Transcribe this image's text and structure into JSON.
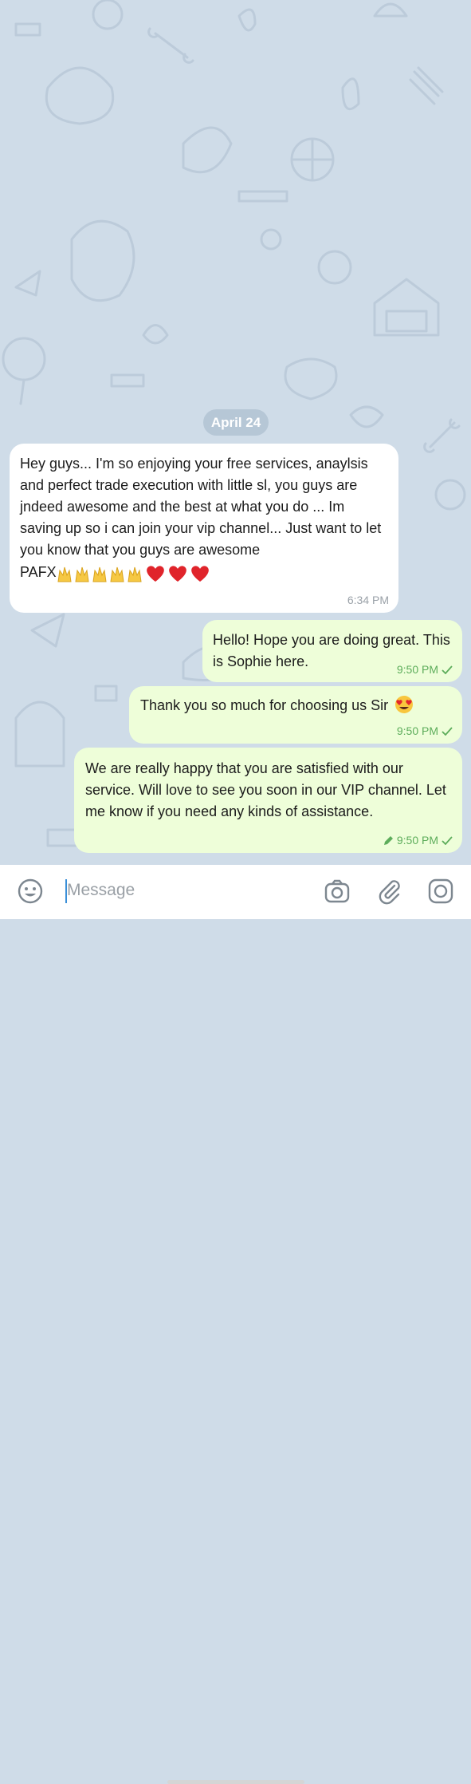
{
  "chat": {
    "date_separator": "April 24",
    "messages": [
      {
        "direction": "incoming",
        "text": "Hey guys... I'm so enjoying your free services, anaylsis and perfect trade execution with little sl, you guys are jndeed awesome and the best at what you do ... Im saving up so i can join your vip channel... Just want to let you know that you guys are awesome",
        "signature": "PAFX",
        "emoji": [
          "raising-hands",
          "raising-hands",
          "raising-hands",
          "raising-hands",
          "raising-hands",
          "red-heart",
          "red-heart",
          "red-heart"
        ],
        "time": "6:34 PM"
      },
      {
        "direction": "outgoing",
        "text": "Hello! Hope you are doing great. This is Sophie here.",
        "time": "9:50 PM",
        "status": "sent-check"
      },
      {
        "direction": "outgoing",
        "text": "Thank you so much for choosing us Sir",
        "emoji": [
          "heart-eyes"
        ],
        "time": "9:50 PM",
        "status": "sent-check"
      },
      {
        "direction": "outgoing",
        "text": "We are really happy that you are satisfied with our service. Will love to see you soon in our VIP channel. Let me know if you need any kinds of assistance.",
        "edited_icon": "pencil-icon",
        "time": "9:50 PM",
        "status": "sent-check"
      }
    ]
  },
  "input_bar": {
    "placeholder": "Message",
    "icons": [
      "emoji-icon",
      "camera-icon",
      "attach-icon",
      "instagram-icon"
    ]
  },
  "colors": {
    "wallpaper": "#cfdce8",
    "incoming_bubble": "#ffffff",
    "outgoing_bubble": "#eefed9",
    "outgoing_meta": "#5dad5b",
    "date_pill": "#b6c7d6"
  }
}
